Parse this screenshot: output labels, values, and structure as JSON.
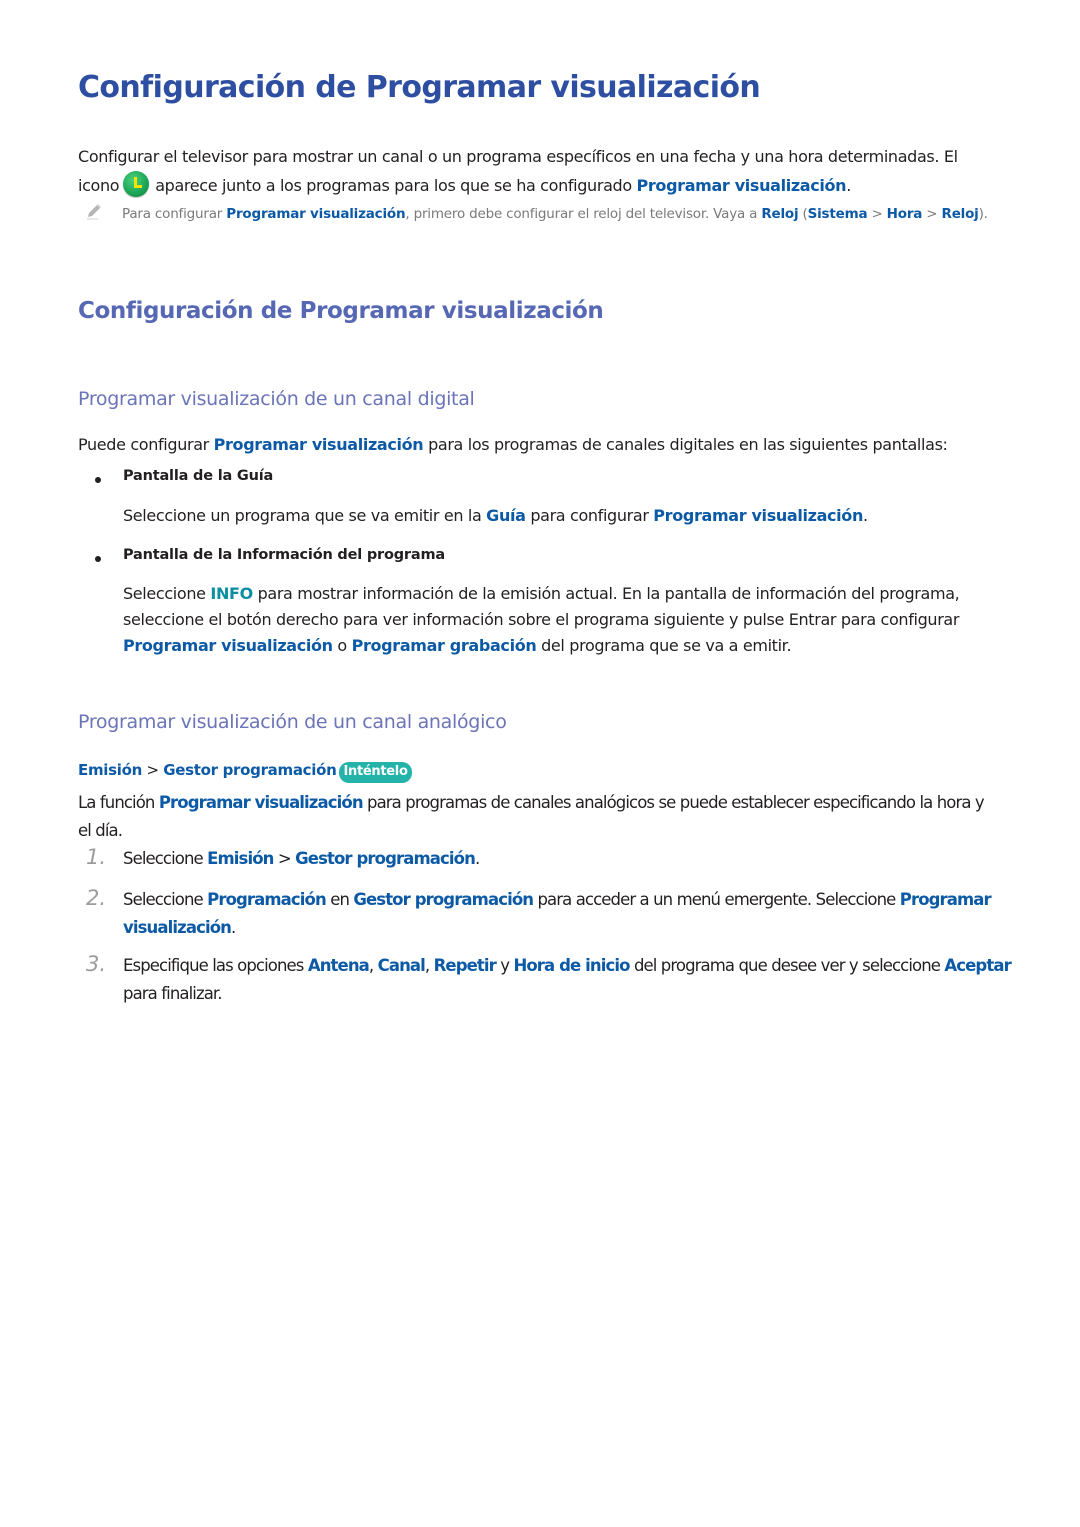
{
  "title": "Configuración de Programar visualización",
  "intro": {
    "line1": "Configurar el televisor para mostrar un canal o un programa específicos en una fecha y una hora determinadas. El",
    "line2_before_icon": "icono",
    "icon": "clock-icon",
    "line2_after_icon": "aparece junto a los programas para los que se ha configurado ",
    "line2_link": "Programar visualización",
    "line2_end": "."
  },
  "note": {
    "icon": "pencil-icon",
    "t1": "Para configurar ",
    "l1": "Programar visualización",
    "t2": ", primero debe configurar el reloj del televisor. Vaya a ",
    "l2": "Reloj",
    "t3": " (",
    "l3": "Sistema",
    "sep1": " > ",
    "l4": "Hora",
    "sep2": " > ",
    "l5": "Reloj",
    "t4": ")."
  },
  "section_title": "Configuración de Programar visualización",
  "digital": {
    "heading": "Programar visualización de un canal digital",
    "intro_t1": "Puede configurar ",
    "intro_link": "Programar visualización",
    "intro_t2": " para los programas de canales digitales en las siguientes pantallas:",
    "bullets": [
      {
        "title": "Pantalla de la Guía",
        "t1": "Seleccione un programa que se va emitir en la ",
        "l1": "Guía",
        "t2": " para configurar ",
        "l2": "Programar visualización",
        "t3": "."
      },
      {
        "title": "Pantalla de la Información del programa",
        "t1": "Seleccione ",
        "l1": "INFO",
        "t2": " para mostrar información de la emisión actual. En la pantalla de información del programa, seleccione el botón derecho para ver información sobre el programa siguiente y pulse Entrar para configurar ",
        "l2": "Programar visualización",
        "t3": " o ",
        "l3": "Programar grabación",
        "t4": " del programa que se va a emitir."
      }
    ]
  },
  "analog": {
    "heading": "Programar visualización de un canal analógico",
    "path": {
      "item1": "Emisión",
      "sep": " > ",
      "item2": "Gestor programación",
      "badge": "Inténtelo"
    },
    "intro_t1": "La función ",
    "intro_link": "Programar visualización",
    "intro_t2": " para programas de canales analógicos se puede establecer especificando la hora y el día.",
    "steps": [
      {
        "num": "1.",
        "t1": "Seleccione ",
        "l1": "Emisión",
        "t2": " > ",
        "l2": "Gestor programación",
        "t3": "."
      },
      {
        "num": "2.",
        "t1": "Seleccione ",
        "l1": "Programación",
        "t2": " en ",
        "l2": "Gestor programación",
        "t3": " para acceder a un menú emergente. Seleccione ",
        "l3": "Programar visualización",
        "t4": "."
      },
      {
        "num": "3.",
        "t1": "Especifique las opciones ",
        "l1": "Antena",
        "t2": ", ",
        "l2": "Canal",
        "t3": ", ",
        "l3": "Repetir",
        "t4": " y ",
        "l4": "Hora de inicio",
        "t5": " del programa que desee ver y seleccione ",
        "l5": "Aceptar",
        "t6": " para finalizar."
      }
    ]
  },
  "colors": {
    "title": "#2e4fa1",
    "section": "#5667b4",
    "subsection": "#6b74b8",
    "link": "#0c5aa6",
    "info": "#0a8fa0",
    "badge": "#23b3a8",
    "clock": "#1ba356"
  }
}
